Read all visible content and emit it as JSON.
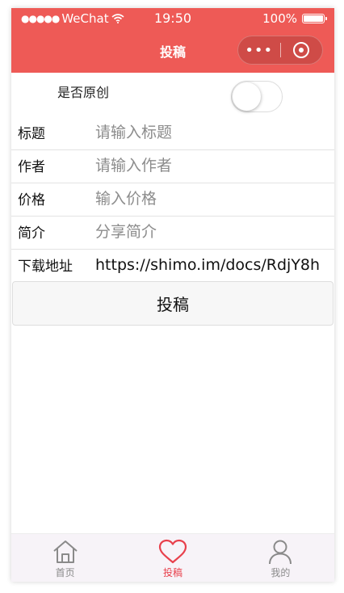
{
  "status_bar": {
    "carrier": "WeChat",
    "time": "19:50",
    "battery": "100%"
  },
  "nav": {
    "title": "投稿",
    "capsule_more": "•••"
  },
  "form": {
    "original_label": "是否原创",
    "original_on": false,
    "fields": [
      {
        "label": "标题",
        "placeholder": "请输入标题",
        "value": ""
      },
      {
        "label": "作者",
        "placeholder": "请输入作者",
        "value": ""
      },
      {
        "label": "价格",
        "placeholder": "输入价格",
        "value": ""
      },
      {
        "label": "简介",
        "placeholder": "分享简介",
        "value": ""
      },
      {
        "label": "下载地址",
        "placeholder": "",
        "value": "https://shimo.im/docs/RdjY8h"
      }
    ],
    "submit_label": "投稿"
  },
  "tabbar": {
    "items": [
      {
        "label": "首页",
        "icon": "home-icon",
        "active": false
      },
      {
        "label": "投稿",
        "icon": "heart-icon",
        "active": true
      },
      {
        "label": "我的",
        "icon": "person-icon",
        "active": false
      }
    ]
  },
  "colors": {
    "accent": "#EE5A56",
    "tab_active": "#E8404C",
    "tab_inactive": "#8a8a8a"
  }
}
